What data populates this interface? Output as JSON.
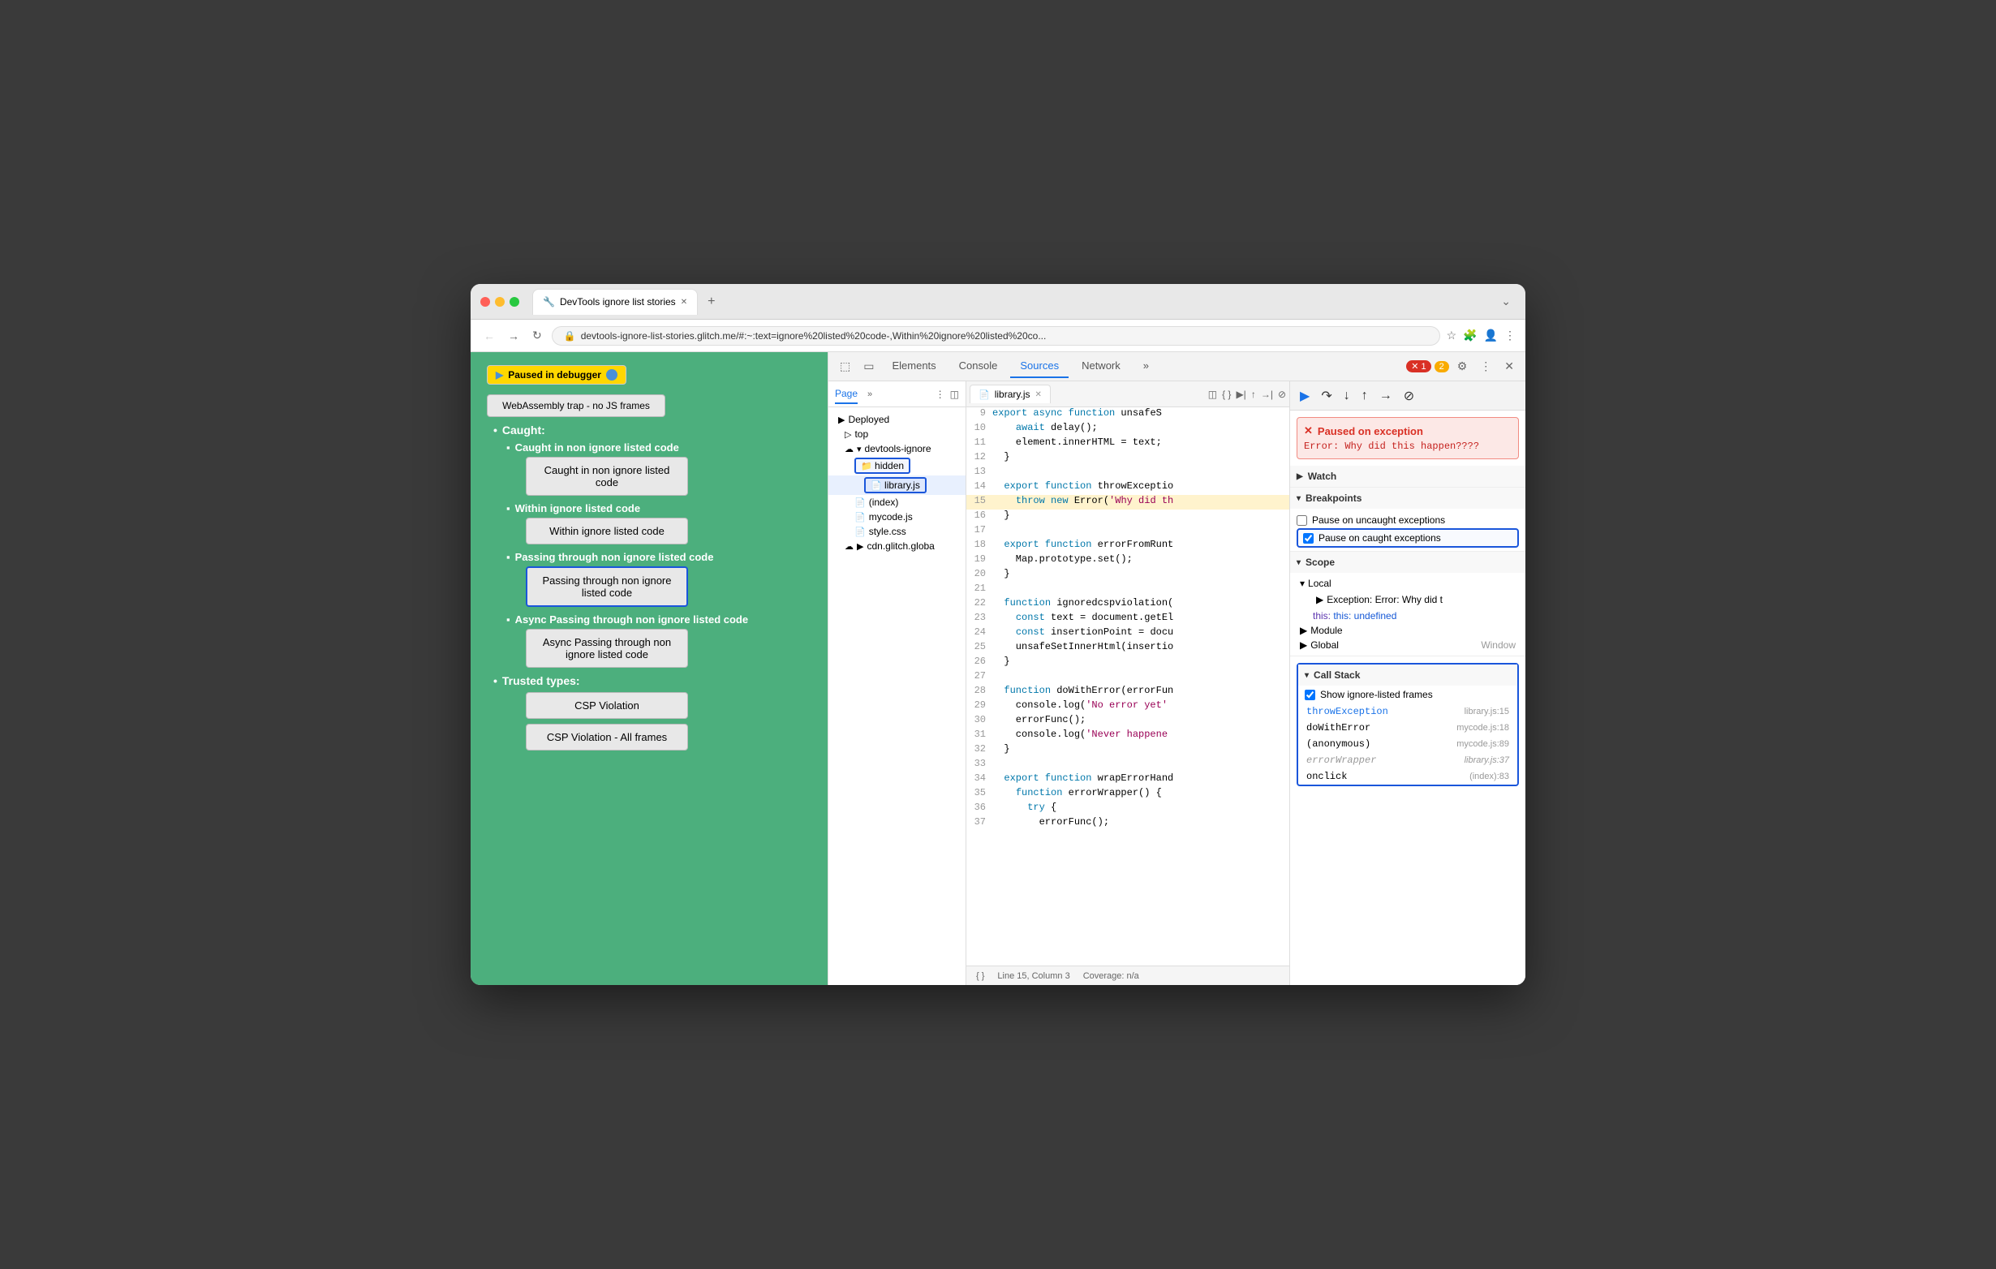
{
  "window": {
    "title": "DevTools ignore list stories",
    "tab_label": "DevTools ignore list stories",
    "url": "devtools-ignore-list-stories.glitch.me/#:~:text=ignore%20listed%20code-,Within%20ignore%20listed%20co..."
  },
  "nav": {
    "back": "←",
    "forward": "→",
    "refresh": "↻",
    "lock": "🔒"
  },
  "page": {
    "debugger_badge": "Paused in debugger",
    "webasm": "WebAssembly trap - no JS frames",
    "caught_section": "Caught:",
    "caught_items": [
      {
        "label": "Caught in non ignore listed code",
        "btn": "Caught in non ignore listed code"
      },
      {
        "label": "Within ignore listed code",
        "btn": "Within ignore listed code"
      },
      {
        "label": "Passing through non ignore listed code",
        "btn": "Passing through non ignore listed code",
        "active": true
      },
      {
        "label": "Async Passing through non ignore listed code",
        "btn": "Async Passing through non ignore listed code"
      }
    ],
    "trusted_types": "Trusted types:",
    "trusted_items": [
      "CSP Violation",
      "CSP Violation - All frames"
    ]
  },
  "devtools": {
    "tabs": [
      "Elements",
      "Console",
      "Sources",
      "Network"
    ],
    "active_tab": "Sources",
    "error_count": "1",
    "warn_count": "2"
  },
  "sources_panel": {
    "title": "Sources",
    "left_tabs": [
      "Page",
      "»"
    ],
    "file_tree": [
      {
        "label": "Deployed",
        "icon": "▶",
        "indent": 0
      },
      {
        "label": "top",
        "icon": "▷",
        "indent": 1
      },
      {
        "label": "devtools-ignore",
        "icon": "▾",
        "cloud": true,
        "indent": 1
      },
      {
        "label": "hidden",
        "icon": "▶",
        "folder": true,
        "indent": 2,
        "highlight": true
      },
      {
        "label": "library.js",
        "icon": "📄",
        "indent": 3,
        "highlight": true
      },
      {
        "label": "(index)",
        "icon": "📄",
        "indent": 2
      },
      {
        "label": "mycode.js",
        "icon": "📄",
        "red": true,
        "indent": 2
      },
      {
        "label": "style.css",
        "icon": "📄",
        "red": true,
        "indent": 2
      },
      {
        "label": "cdn.glitch.globa",
        "icon": "▶",
        "cloud": true,
        "indent": 1
      }
    ]
  },
  "code_editor": {
    "filename": "library.js",
    "lines": [
      {
        "num": "9",
        "content": "  export async function unsafeS",
        "highlight": false
      },
      {
        "num": "10",
        "content": "    await delay();",
        "highlight": false
      },
      {
        "num": "11",
        "content": "    element.innerHTML = text;",
        "highlight": false
      },
      {
        "num": "12",
        "content": "  }",
        "highlight": false
      },
      {
        "num": "13",
        "content": "",
        "highlight": false
      },
      {
        "num": "14",
        "content": "  export function throwExceptio",
        "highlight": false
      },
      {
        "num": "15",
        "content": "    throw new Error('Why did th",
        "highlight": true
      },
      {
        "num": "16",
        "content": "  }",
        "highlight": false
      },
      {
        "num": "17",
        "content": "",
        "highlight": false
      },
      {
        "num": "18",
        "content": "  export function errorFromRunt",
        "highlight": false
      },
      {
        "num": "19",
        "content": "    Map.prototype.set();",
        "highlight": false
      },
      {
        "num": "20",
        "content": "  }",
        "highlight": false
      },
      {
        "num": "21",
        "content": "",
        "highlight": false
      },
      {
        "num": "22",
        "content": "  function ignoredcspviolation(",
        "highlight": false
      },
      {
        "num": "23",
        "content": "    const text = document.getEl",
        "highlight": false
      },
      {
        "num": "24",
        "content": "    const insertionPoint = docu",
        "highlight": false
      },
      {
        "num": "25",
        "content": "    unsafeSetInnerHtml(insertio",
        "highlight": false
      },
      {
        "num": "26",
        "content": "  }",
        "highlight": false
      },
      {
        "num": "27",
        "content": "",
        "highlight": false
      },
      {
        "num": "28",
        "content": "  function doWithError(errorFun",
        "highlight": false
      },
      {
        "num": "29",
        "content": "    console.log('No error yet'",
        "highlight": false
      },
      {
        "num": "30",
        "content": "    errorFunc();",
        "highlight": false
      },
      {
        "num": "31",
        "content": "    console.log('Never happene",
        "highlight": false
      },
      {
        "num": "32",
        "content": "  }",
        "highlight": false
      },
      {
        "num": "33",
        "content": "",
        "highlight": false
      },
      {
        "num": "34",
        "content": "  export function wrapErrorHand",
        "highlight": false
      },
      {
        "num": "35",
        "content": "    function errorWrapper() {",
        "highlight": false
      },
      {
        "num": "36",
        "content": "      try {",
        "highlight": false
      },
      {
        "num": "37",
        "content": "        errorFunc();",
        "highlight": false
      }
    ],
    "status_line": "Line 15, Column 3",
    "coverage": "Coverage: n/a"
  },
  "right_panel": {
    "exception": {
      "title": "Paused on exception",
      "message": "Error: Why did this happen????"
    },
    "watch_label": "Watch",
    "breakpoints_label": "Breakpoints",
    "pause_uncaught_label": "Pause on uncaught exceptions",
    "pause_caught_label": "Pause on caught exceptions",
    "pause_caught_checked": true,
    "pause_uncaught_checked": false,
    "scope_label": "Scope",
    "local_label": "Local",
    "exception_item": "Exception: Error: Why did t",
    "this_item": "this: undefined",
    "module_label": "Module",
    "global_label": "Global",
    "global_val": "Window",
    "callstack_label": "Call Stack",
    "show_ignored_label": "Show ignore-listed frames",
    "show_ignored_checked": true,
    "call_stack_items": [
      {
        "fn": "throwException",
        "src": "library.js:15",
        "current": true
      },
      {
        "fn": "doWithError",
        "src": "mycode.js:18",
        "current": false
      },
      {
        "fn": "(anonymous)",
        "src": "mycode.js:89",
        "current": false
      },
      {
        "fn": "errorWrapper",
        "src": "library.js:37",
        "dimmed": true
      },
      {
        "fn": "onclick",
        "src": "(index):83",
        "current": false
      }
    ]
  }
}
